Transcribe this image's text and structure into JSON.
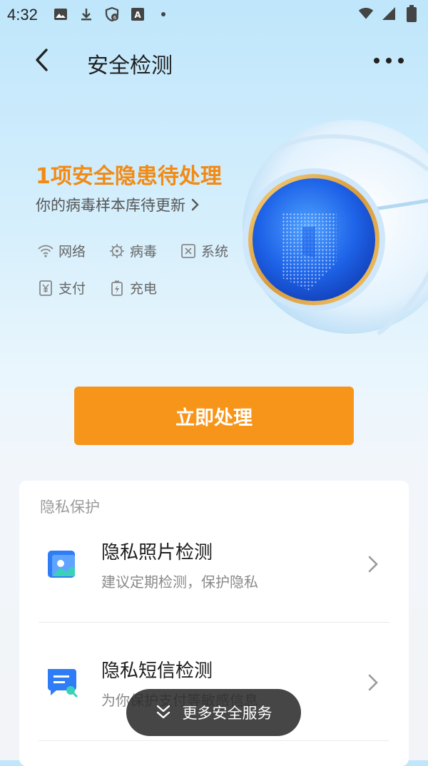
{
  "status_bar": {
    "time": "4:32",
    "icons_left": [
      "image-icon",
      "download-icon",
      "vpn-shield-icon",
      "font-icon",
      "dot-icon"
    ],
    "icons_right": [
      "wifi-icon",
      "signal-icon",
      "battery-icon"
    ]
  },
  "header": {
    "title": "安全检测",
    "back_icon": "chevron-left-icon",
    "more_icon": "more-dots-icon"
  },
  "alert": {
    "title": "1项安全隐患待处理",
    "subtitle": "你的病毒样本库待更新",
    "accent": "#f28a13"
  },
  "checks": [
    {
      "label": "网络",
      "icon": "wifi-check-icon"
    },
    {
      "label": "病毒",
      "icon": "virus-check-icon"
    },
    {
      "label": "系统",
      "icon": "system-check-icon"
    },
    {
      "label": "支付",
      "icon": "payment-check-icon"
    },
    {
      "label": "充电",
      "icon": "charging-check-icon"
    }
  ],
  "primary_button": {
    "label": "立即处理",
    "color": "#f7951b"
  },
  "privacy_card": {
    "title": "隐私保护",
    "items": [
      {
        "title": "隐私照片检测",
        "description": "建议定期检测，保护隐私",
        "icon": "photo-privacy-icon"
      },
      {
        "title": "隐私短信检测",
        "description": "为你保护支付等敏感信息",
        "icon": "sms-privacy-icon"
      }
    ]
  },
  "floating_button": {
    "label": "更多安全服务",
    "icon": "double-chevron-down-icon"
  }
}
